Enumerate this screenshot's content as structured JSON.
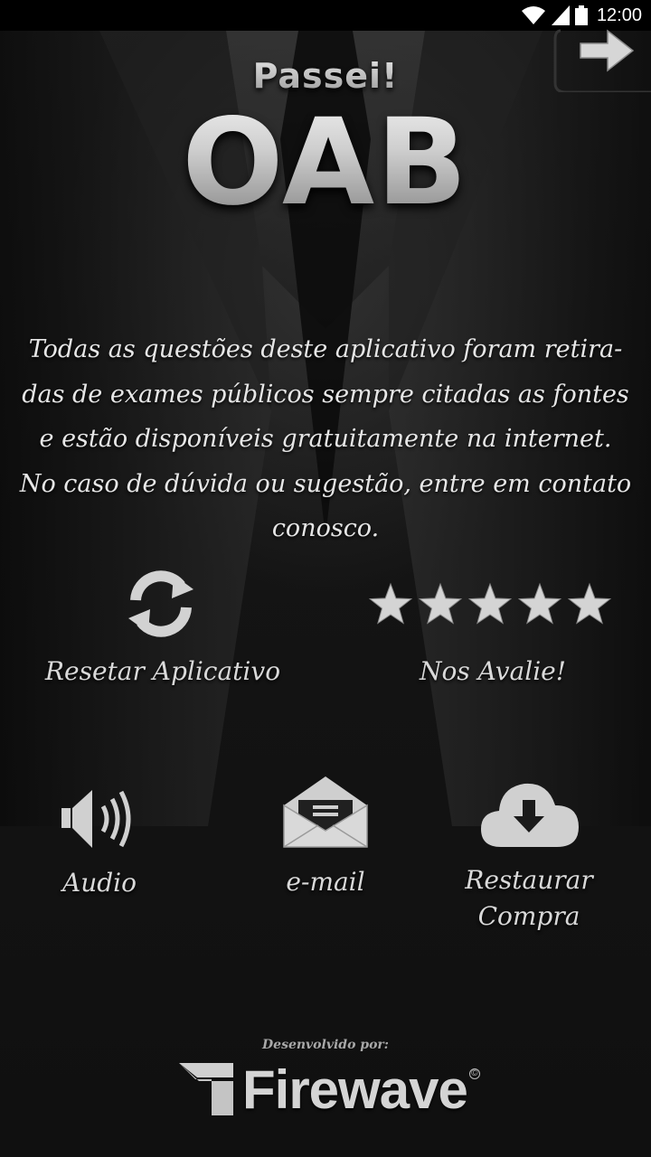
{
  "status_bar": {
    "time": "12:00",
    "icons": [
      "wifi-icon",
      "signal-icon",
      "battery-icon"
    ]
  },
  "header": {
    "next_icon": "arrow-right-icon",
    "subtitle": "Passei!",
    "title": "OAB"
  },
  "description": {
    "lines": [
      "Todas as questões deste aplicativo foram retira-",
      "das de exames públicos sempre citadas as fontes",
      "e estão disponíveis gratuitamente na internet.",
      "No caso de dúvida ou sugestão, entre em contato",
      "conosco."
    ]
  },
  "actions": {
    "reset": {
      "label": "Resetar Aplicativo",
      "icon": "refresh-icon"
    },
    "rate": {
      "label": "Nos Avalie!",
      "icon": "star-icon",
      "stars": 5
    },
    "audio": {
      "label": "Audio",
      "icon": "speaker-icon"
    },
    "email": {
      "label": "e-mail",
      "icon": "envelope-icon"
    },
    "restore": {
      "label_line1": "Restaurar",
      "label_line2": "Compra",
      "icon": "cloud-download-icon"
    }
  },
  "footer": {
    "developed_by": "Desenvolvido por:",
    "brand": "Firewave",
    "brand_icon": "firewave-logo-icon"
  },
  "colors": {
    "background": "#141414",
    "icon": "#d0d0d0",
    "text": "#e6e6e6"
  }
}
